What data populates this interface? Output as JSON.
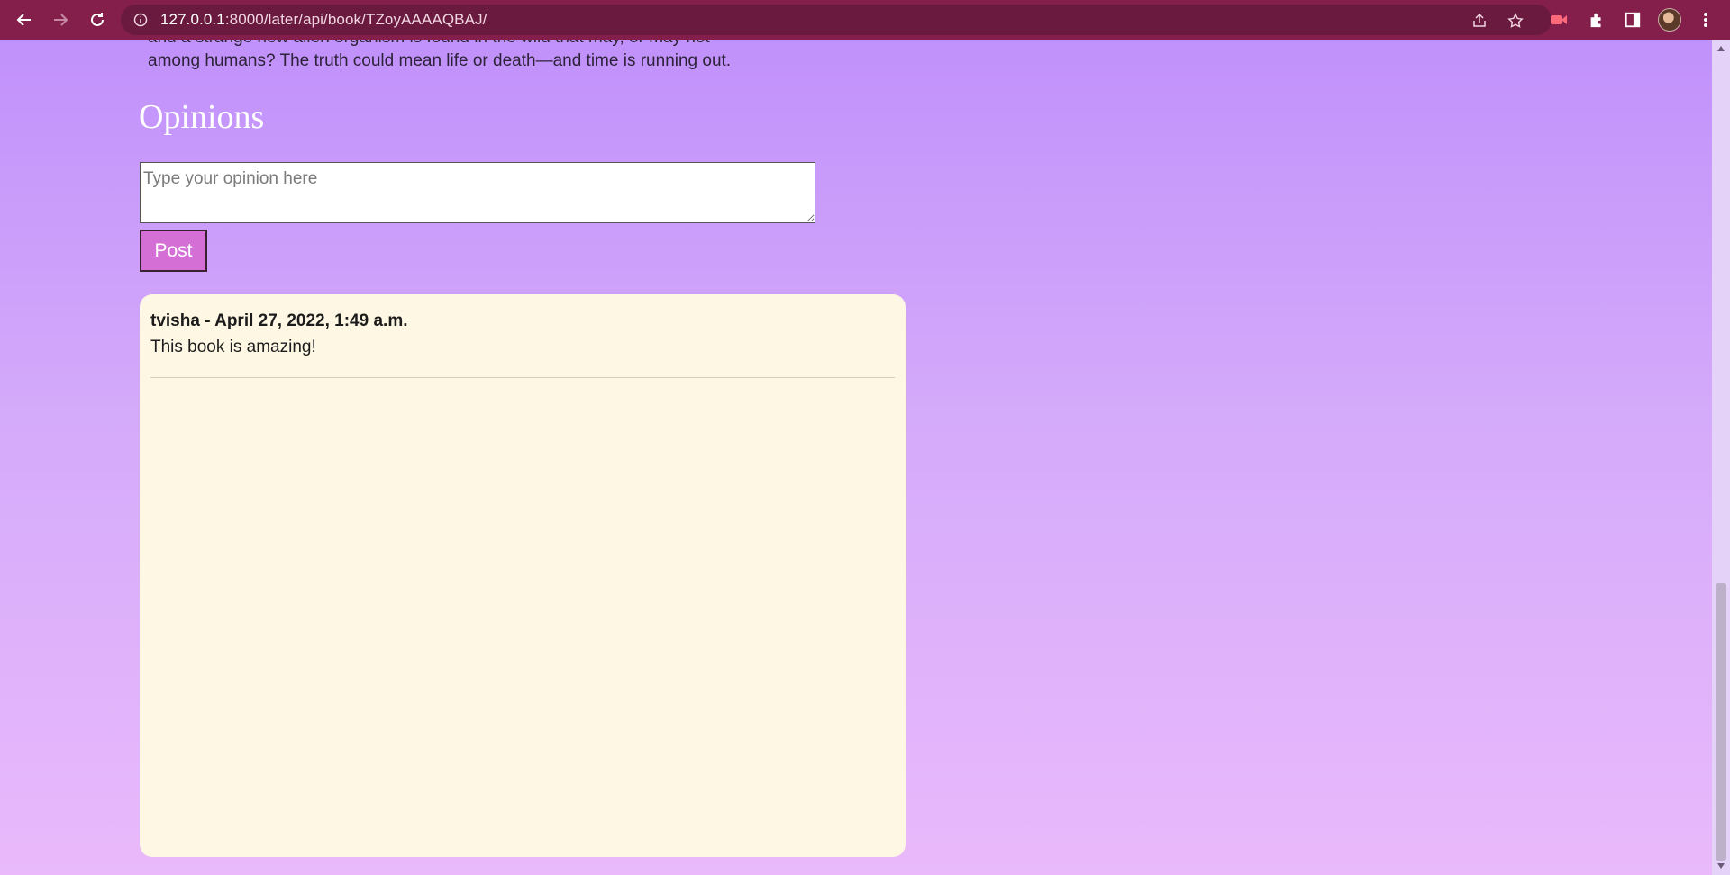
{
  "browser": {
    "url_host": "127.0.0.1",
    "url_rest": ":8000/later/api/book/TZoyAAAAQBAJ/"
  },
  "book": {
    "description_faded": "and a strange new alien organism is found in the wild that may, or may not",
    "description_line": "among humans? The truth could mean life or death—and time is running out."
  },
  "opinions": {
    "heading": "Opinions",
    "input_placeholder": "Type your opinion here",
    "post_label": "Post",
    "comments": [
      {
        "author_line": "tvisha - April 27, 2022, 1:49 a.m.",
        "text": "This book is amazing!"
      }
    ]
  },
  "colors": {
    "toolbar": "#831f4a",
    "page_top": "#c191fb",
    "page_bottom": "#e9b9fb",
    "card": "#fdf7e4",
    "post_button": "#d46fd6"
  }
}
